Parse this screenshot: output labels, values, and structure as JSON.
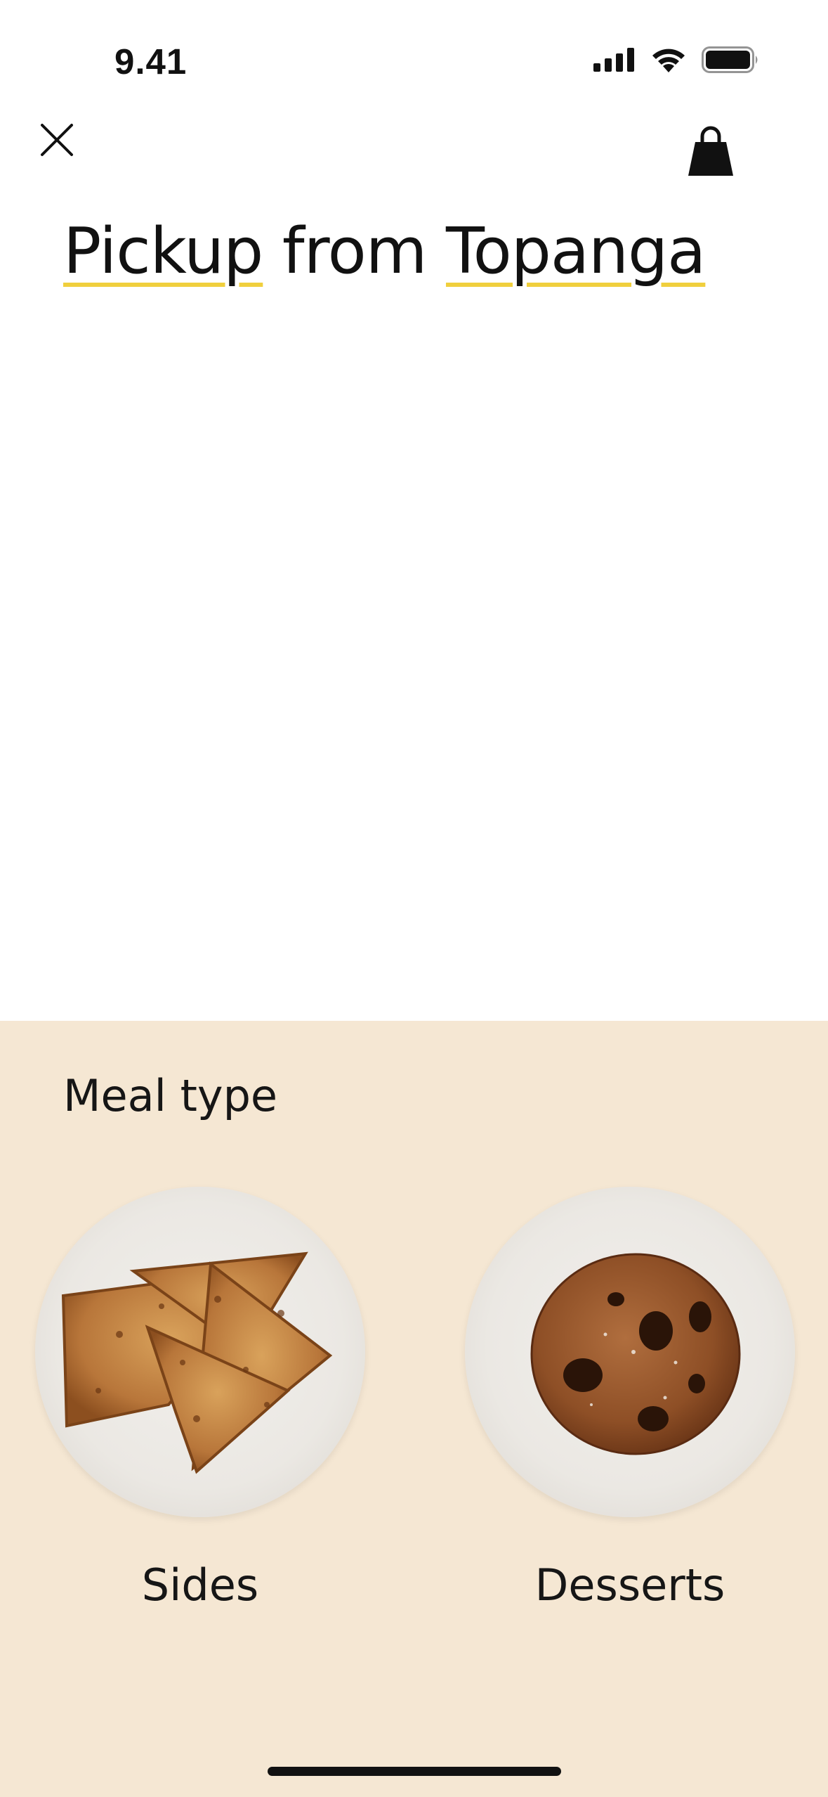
{
  "status_bar": {
    "time": "9.41",
    "icons": [
      "cellular-signal-icon",
      "wifi-icon",
      "battery-icon"
    ]
  },
  "header": {
    "close_icon": "close-icon",
    "bag_icon": "shopping-bag-icon"
  },
  "headline": {
    "mode": "Pickup",
    "connector": "from",
    "location": "Topanga",
    "underline_color": "#f0cf3d"
  },
  "meal_section": {
    "title": "Meal type",
    "background": "#f5e7d3",
    "items": [
      {
        "label": "Sides",
        "image": "pita-chips-plate"
      },
      {
        "label": "Desserts",
        "image": "chocolate-chip-cookie-plate"
      }
    ]
  }
}
